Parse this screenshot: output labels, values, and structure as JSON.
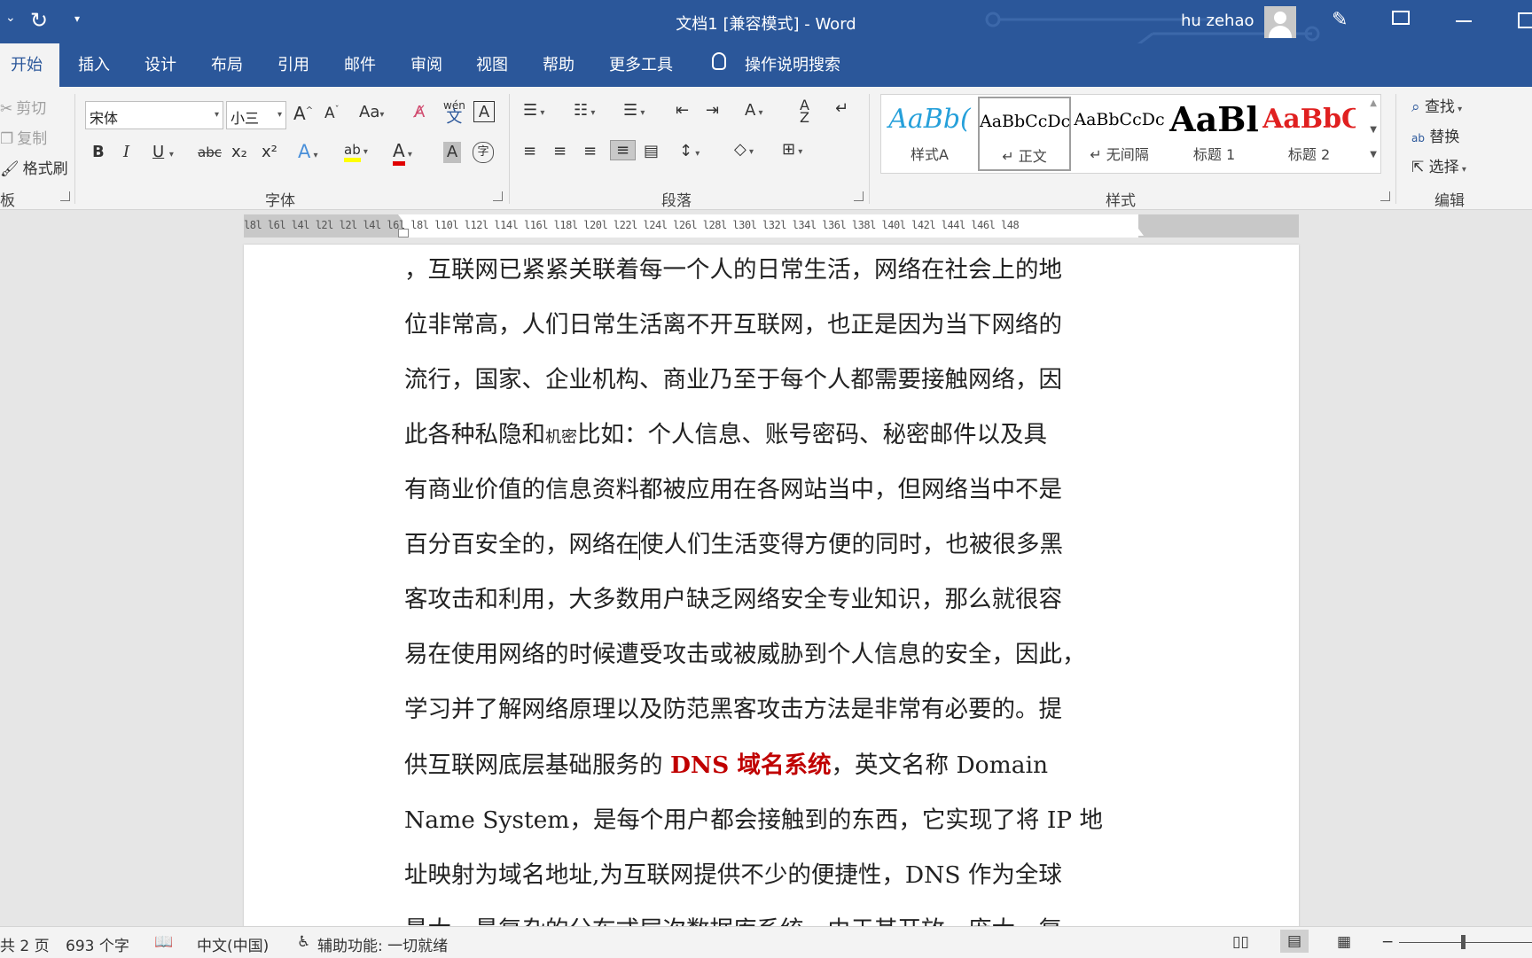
{
  "titlebar": {
    "title": "文档1 [兼容模式]  -  Word",
    "user": "hu zehao"
  },
  "tabs": [
    "开始",
    "插入",
    "设计",
    "布局",
    "引用",
    "邮件",
    "审阅",
    "视图",
    "帮助",
    "更多工具"
  ],
  "tell_me": "操作说明搜索",
  "clipboard": {
    "cut": "剪切",
    "copy": "复制",
    "format_painter": "格式刷",
    "group_label": "板"
  },
  "font": {
    "name": "宋体",
    "size": "小三",
    "group_label": "字体",
    "aa": "Aa",
    "bold": "B",
    "italic": "I",
    "underline": "U",
    "strike": "abc",
    "subscript": "x₂",
    "superscript": "x²",
    "font_color_letter": "A",
    "highlight_letter": "ab",
    "pinyin": "wén",
    "text_a": "A"
  },
  "paragraph": {
    "group_label": "段落"
  },
  "styles": {
    "group_label": "样式",
    "items": [
      {
        "sample": "AaBb(",
        "name": "样式A"
      },
      {
        "sample": "AaBbCcDc",
        "name": "↵ 正文"
      },
      {
        "sample": "AaBbCcDc",
        "name": "↵ 无间隔"
      },
      {
        "sample": "AaBl",
        "name": "标题 1"
      },
      {
        "sample": "AaBbC",
        "name": "标题 2"
      }
    ]
  },
  "editing": {
    "find": "查找",
    "replace": "替换",
    "select": "选择",
    "group_label": "编辑"
  },
  "ruler": {
    "numbers": "l8l  l6l  l4l  l2l      l2l  l4l  l6l  l8l  l10l  l12l  l14l  l16l  l18l  l20l  l22l  l24l  l26l  l28l  l30l  l32l  l34l  l36l  l38l  l40l  l42l  l44l  l46l  l48"
  },
  "document": {
    "lines": [
      "，互联网已紧紧关联着每一个人的日常生活，网络在社会上的地",
      "位非常高，人们日常生活离不开互联网，也正是因为当下网络的",
      "流行，国家、企业机构、商业乃至于每个人都需要接触网络，因",
      "有商业价值的信息资料都被应用在各网站当中，但网络当中不是",
      "客攻击和利用，大多数用户缺乏网络安全专业知识，那么就很容",
      "易在使用网络的时候遭受攻击或被威胁到个人信息的安全，因此，",
      "学习并了解网络原理以及防范黑客攻击方法是非常有必要的。提",
      "Name System，是每个用户都会接触到的东西，它实现了将 IP 地",
      "址映射为域名地址,为互联网提供不少的便捷性，DNS 作为全球"
    ],
    "line4_a": "此各种私隐和",
    "line4_small": "机密",
    "line4_b": "比如：个人信息、账号密码、秘密邮件以及具",
    "line6_a": "百分百安全的，网络在",
    "line6_b": "使人们生活变得方便的同时，也被很多黑",
    "line10_a": "供互联网底层基础服务的 ",
    "line10_red": "DNS  域名系统",
    "line10_b": "，英文名称  Domain",
    "line13_partial": "最大、最复杂的分布式层次数据库系统，由于其开放、庞大、复"
  },
  "status": {
    "pages": "共 2 页",
    "words": "693 个字",
    "language": "中文(中国)",
    "accessibility": "辅助功能: 一切就绪"
  }
}
